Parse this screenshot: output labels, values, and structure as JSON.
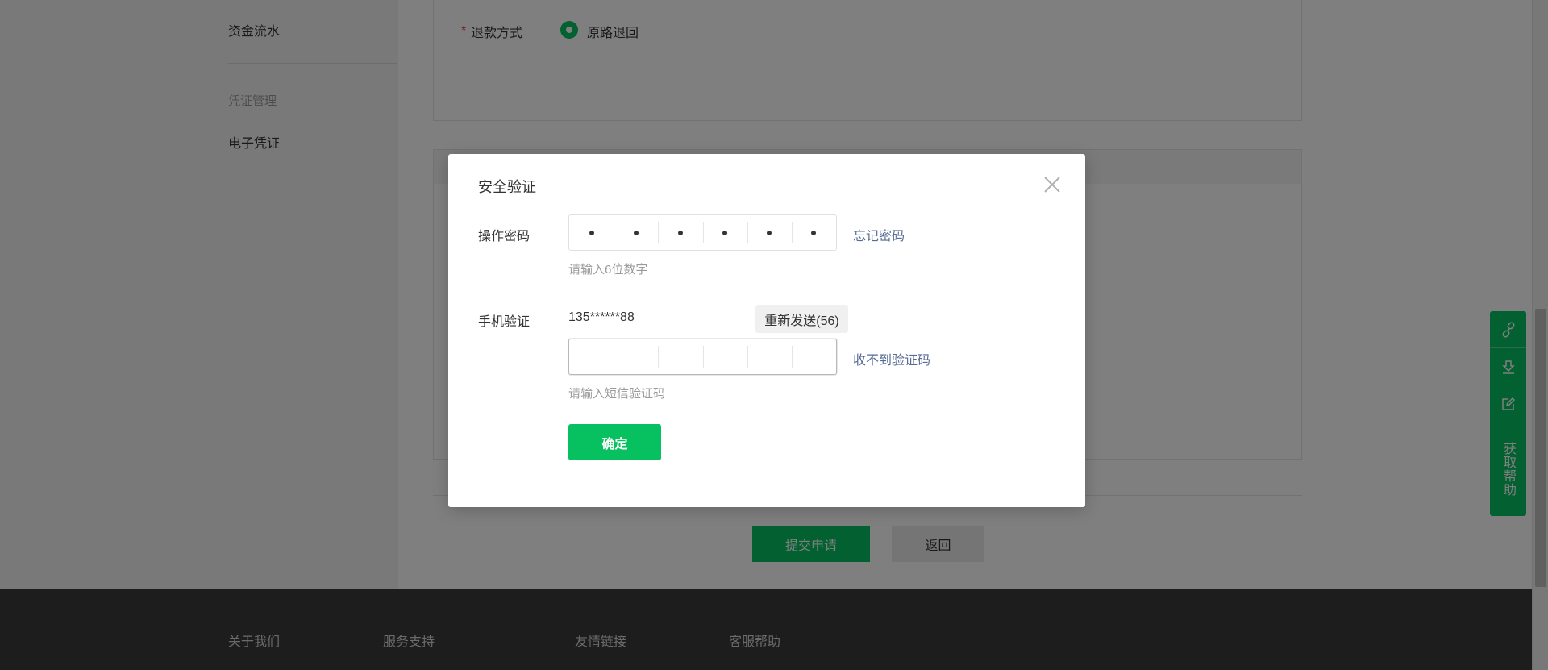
{
  "sidebar": {
    "item_funds": "资金流水",
    "group_voucher": "凭证管理",
    "item_evoucher": "电子凭证"
  },
  "form": {
    "refund_label": "退款方式",
    "refund_option": "原路退回",
    "submit_label": "提交申请",
    "back_label": "返回"
  },
  "footer": {
    "about": "关于我们",
    "service": "服务支持",
    "links": "友情链接",
    "help": "客服帮助"
  },
  "float_bar": {
    "icons": [
      "link-icon",
      "download-icon",
      "edit-icon"
    ],
    "help_label": "获取帮助"
  },
  "modal": {
    "title": "安全验证",
    "password": {
      "label": "操作密码",
      "filled_count": 6,
      "total_count": 6,
      "forgot_link": "忘记密码",
      "hint": "请输入6位数字"
    },
    "sms": {
      "label": "手机验证",
      "phone": "135******88",
      "resend_label": "重新发送(56)",
      "not_received_link": "收不到验证码",
      "hint": "请输入短信验证码",
      "total_count": 6
    },
    "confirm_label": "确定"
  },
  "colors": {
    "brand_green": "#07c160",
    "link_blue": "#576b95"
  }
}
